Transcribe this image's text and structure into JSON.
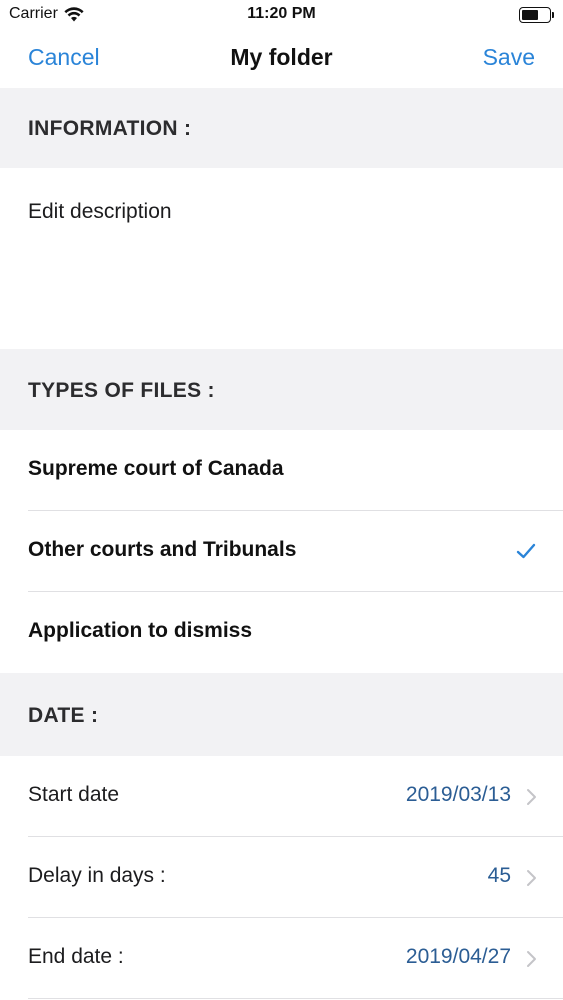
{
  "status_bar": {
    "carrier": "Carrier",
    "time": "11:20 PM",
    "icons": [
      "wifi-icon",
      "battery-icon"
    ]
  },
  "nav": {
    "cancel_label": "Cancel",
    "title": "My folder",
    "save_label": "Save"
  },
  "sections": {
    "information": "INFORMATION :",
    "types_of_files": "TYPES OF FILES :",
    "date": "DATE :"
  },
  "description": {
    "placeholder": "Edit description"
  },
  "file_types": [
    {
      "label": "Supreme court of Canada",
      "selected": false
    },
    {
      "label": "Other courts and Tribunals",
      "selected": true
    },
    {
      "label": "Application to dismiss",
      "selected": false
    }
  ],
  "dates": [
    {
      "label": "Start date",
      "value": "2019/03/13"
    },
    {
      "label": "Delay in days :",
      "value": "45"
    },
    {
      "label": "End date :",
      "value": "2019/04/27"
    }
  ],
  "colors": {
    "accent": "#2a84d8",
    "value_text": "#2b5d94",
    "section_background": "#f2f2f4"
  }
}
